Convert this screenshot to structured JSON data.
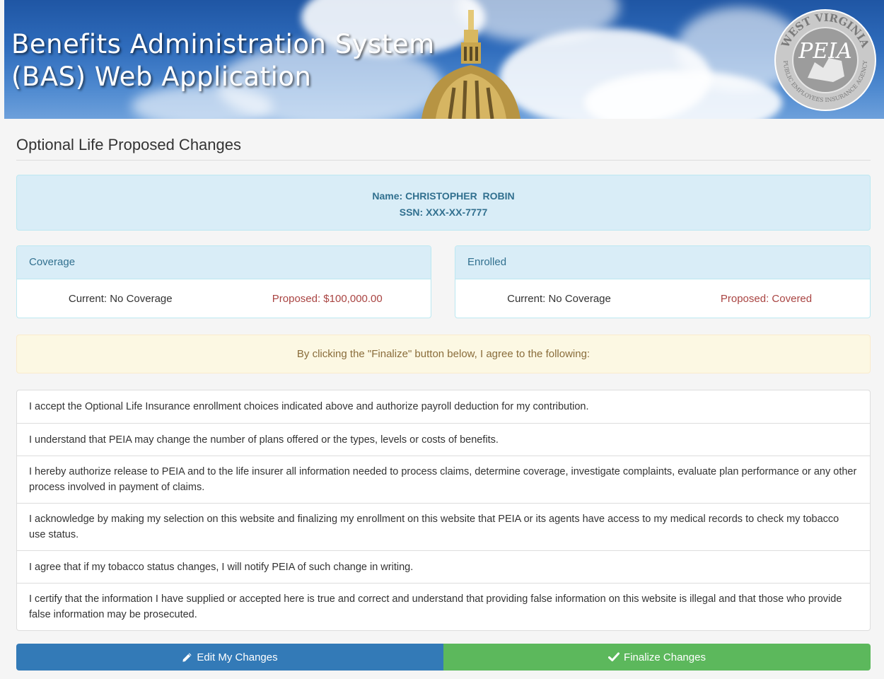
{
  "banner": {
    "title_line1": "Benefits Administration System",
    "title_line2": "(BAS) Web Application",
    "seal": {
      "top_text": "WEST VIRGINIA",
      "bottom_text": "PUBLIC EMPLOYEES INSURANCE AGENCY",
      "center_text": "PEIA"
    }
  },
  "page": {
    "title": "Optional Life Proposed Changes"
  },
  "member": {
    "name_line": "Name: CHRISTOPHER  ROBIN",
    "ssn_line": "SSN: XXX-XX-7777"
  },
  "coverage": {
    "heading": "Coverage",
    "current": "Current: No Coverage",
    "proposed": "Proposed: $100,000.00"
  },
  "enrolled": {
    "heading": "Enrolled",
    "current": "Current: No Coverage",
    "proposed": "Proposed: Covered"
  },
  "agreement": {
    "intro": "By clicking the \"Finalize\" button below, I agree to the following:",
    "items": [
      "I accept the Optional Life Insurance enrollment choices indicated above and authorize payroll deduction for my contribution.",
      "I understand that PEIA may change the number of plans offered or the types, levels or costs of benefits.",
      "I hereby authorize release to PEIA and to the life insurer all information needed to process claims, determine coverage, investigate complaints, evaluate plan performance or any other process involved in payment of claims.",
      "I acknowledge by making my selection on this website and finalizing my enrollment on this website that PEIA or its agents have access to my medical records to check my tobacco use status.",
      "I agree that if my tobacco status changes, I will notify PEIA of such change in writing.",
      "I certify that the information I have supplied or accepted here is true and correct and understand that providing false information on this website is illegal and that those who provide false information may be prosecuted."
    ]
  },
  "buttons": {
    "edit_label": "Edit My Changes",
    "edit_icon": "pencil-icon",
    "finalize_label": "Finalize Changes",
    "finalize_icon": "checkmark-icon"
  },
  "colors": {
    "info_bg": "#d9edf7",
    "info_text": "#31708f",
    "proposed_text": "#a94442",
    "warning_bg": "#fcf8e3",
    "warning_text": "#8a6d3b",
    "edit_button": "#337ab7",
    "finalize_button": "#5cb85c"
  }
}
